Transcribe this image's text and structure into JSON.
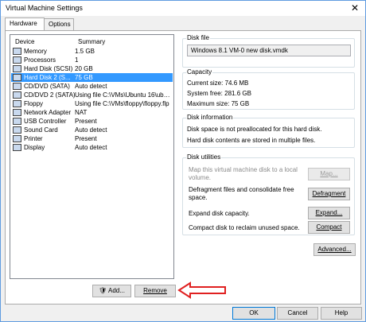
{
  "window": {
    "title": "Virtual Machine Settings"
  },
  "tabs": [
    {
      "label": "Hardware",
      "active": true
    },
    {
      "label": "Options",
      "active": false
    }
  ],
  "devices": {
    "headers": {
      "device": "Device",
      "summary": "Summary"
    },
    "rows": [
      {
        "name": "Memory",
        "summary": "1.5 GB",
        "icon": "memory-icon"
      },
      {
        "name": "Processors",
        "summary": "1",
        "icon": "processor-icon"
      },
      {
        "name": "Hard Disk (SCSI)",
        "summary": "20 GB",
        "icon": "hard-disk-icon"
      },
      {
        "name": "Hard Disk 2 (S...",
        "summary": "75 GB",
        "icon": "hard-disk-icon",
        "selected": true
      },
      {
        "name": "CD/DVD (SATA)",
        "summary": "Auto detect",
        "icon": "cd-dvd-icon"
      },
      {
        "name": "CD/DVD 2 (SATA)",
        "summary": "Using file C:\\VMs\\Ubuntu 16\\ubun...",
        "icon": "cd-dvd-icon"
      },
      {
        "name": "Floppy",
        "summary": "Using file C:\\VMs\\floppy\\floppy.flp",
        "icon": "floppy-icon"
      },
      {
        "name": "Network Adapter",
        "summary": "NAT",
        "icon": "network-adapter-icon"
      },
      {
        "name": "USB Controller",
        "summary": "Present",
        "icon": "usb-icon"
      },
      {
        "name": "Sound Card",
        "summary": "Auto detect",
        "icon": "sound-card-icon"
      },
      {
        "name": "Printer",
        "summary": "Present",
        "icon": "printer-icon"
      },
      {
        "name": "Display",
        "summary": "Auto detect",
        "icon": "display-icon"
      }
    ],
    "add_label": "Add...",
    "remove_label": "Remove"
  },
  "disk_file": {
    "title": "Disk file",
    "value": "Windows 8.1 VM-0 new disk.vmdk"
  },
  "capacity": {
    "title": "Capacity",
    "current_size": "Current size: 74.6 MB",
    "system_free": "System free: 281.6 GB",
    "maximum_size": "Maximum size: 75 GB"
  },
  "disk_information": {
    "title": "Disk information",
    "line1": "Disk space is not preallocated for this hard disk.",
    "line2": "Hard disk contents are stored in multiple files."
  },
  "disk_utilities": {
    "title": "Disk utilities",
    "map_text_1": "Map this virtual machine disk to a local",
    "map_text_2": "volume.",
    "map_button": "Map...",
    "defrag_text_1": "Defragment files and consolidate free",
    "defrag_text_2": "space.",
    "defrag_button": "Defragment",
    "expand_text": "Expand disk capacity.",
    "expand_button": "Expand...",
    "compact_text": "Compact disk to reclaim unused space.",
    "compact_button": "Compact"
  },
  "advanced_button": "Advanced...",
  "footer": {
    "ok": "OK",
    "cancel": "Cancel",
    "help": "Help"
  },
  "colors": {
    "selection": "#3399ff",
    "annotation_arrow": "#e02020",
    "window_border": "#5f9be0"
  }
}
